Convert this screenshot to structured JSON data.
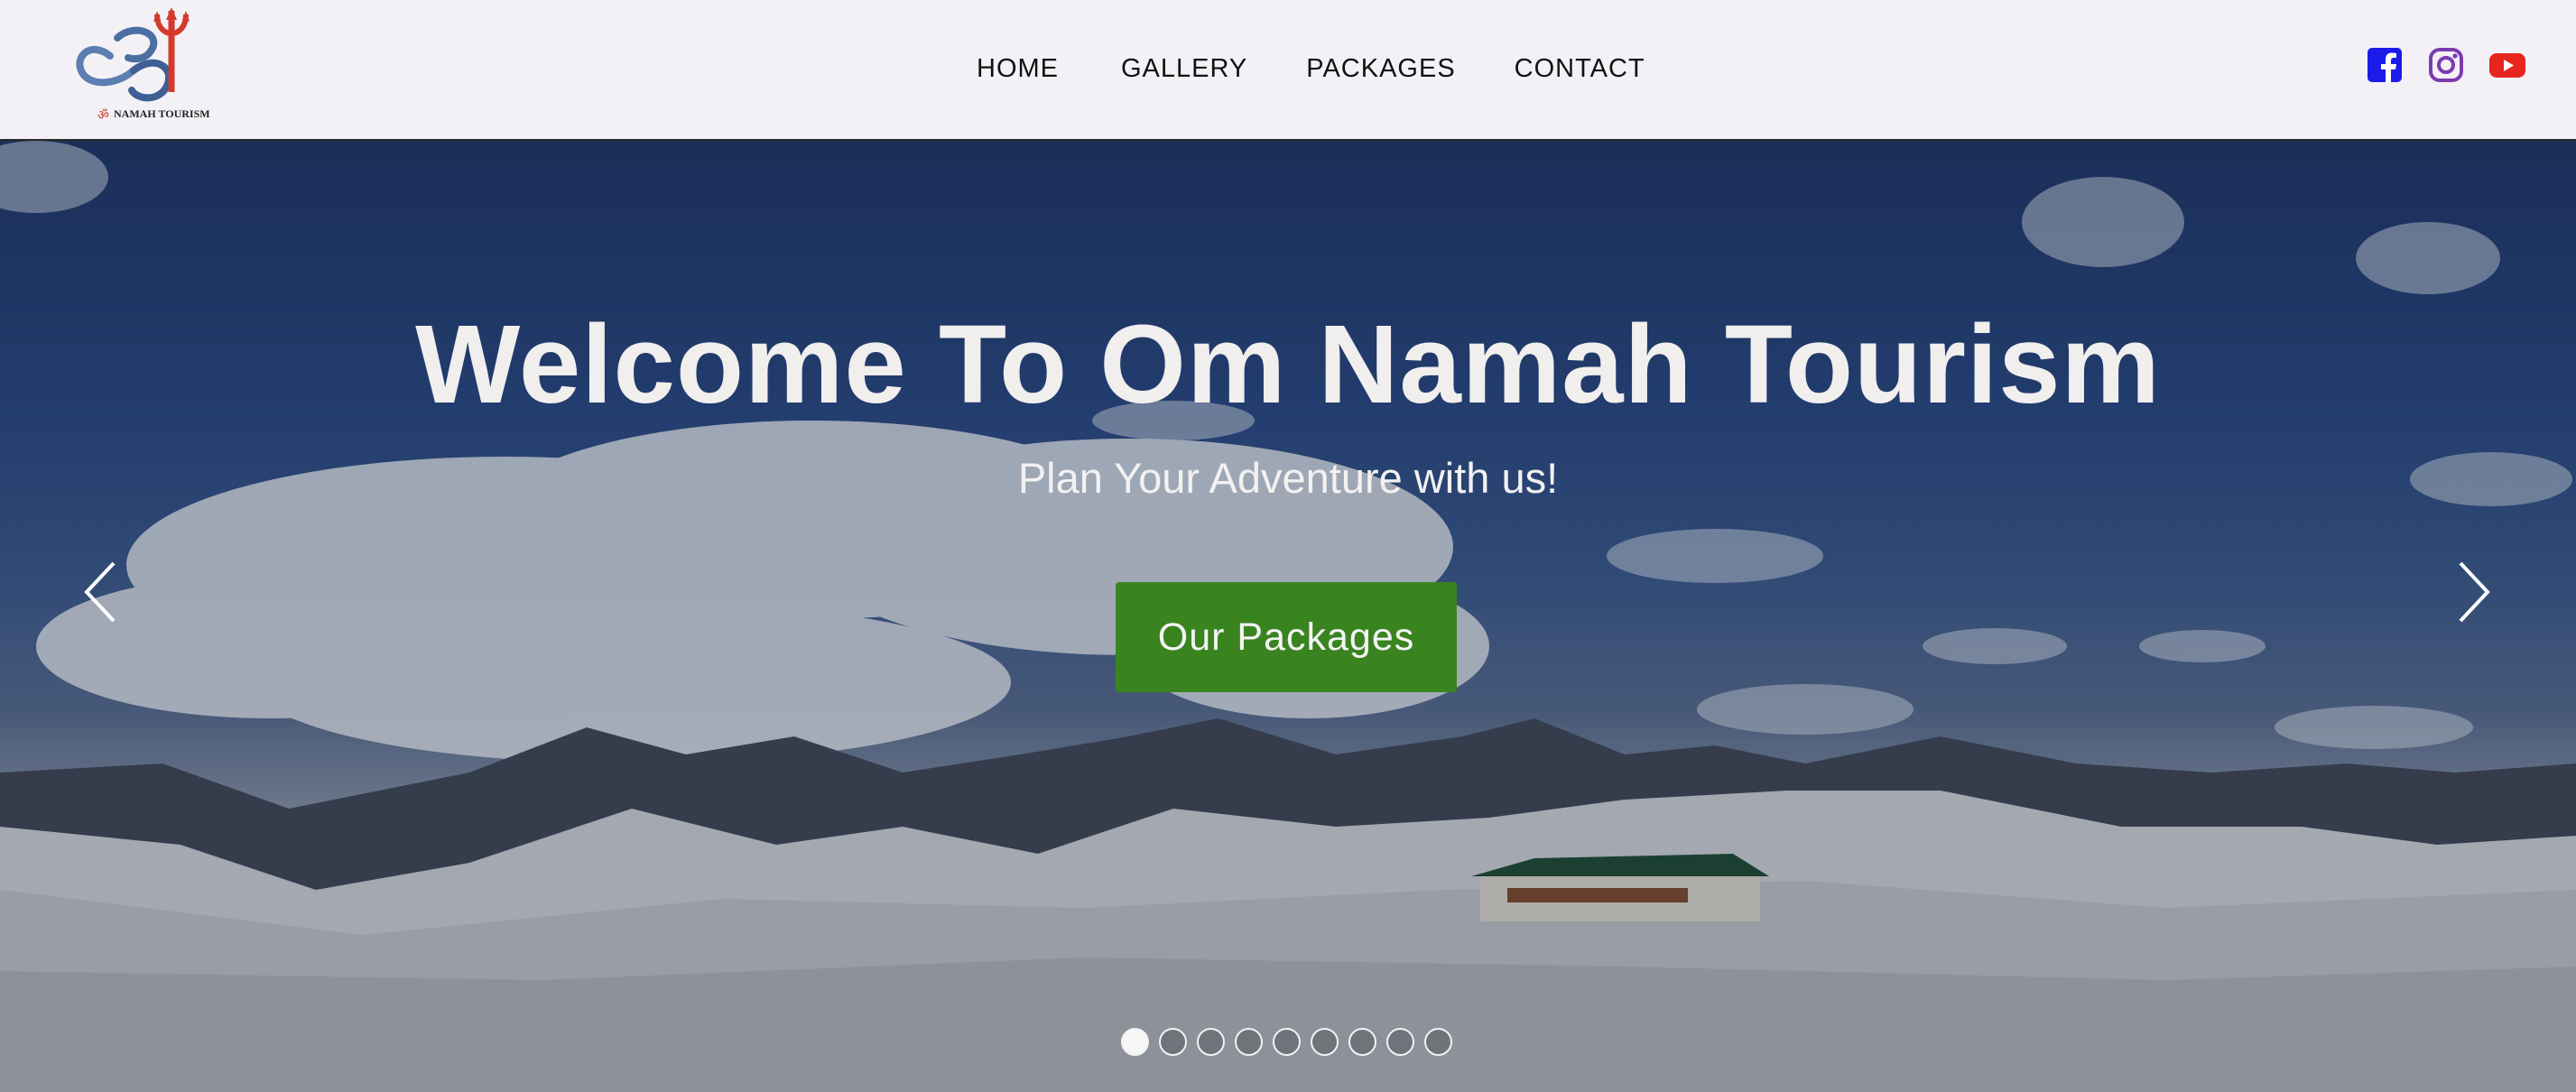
{
  "brand": {
    "logo_text": "NAMAH TOURISM",
    "logo_glyph": "ॐ",
    "logo_mark_text": "3"
  },
  "nav": {
    "items": [
      {
        "label": "HOME"
      },
      {
        "label": "GALLERY"
      },
      {
        "label": "PACKAGES"
      },
      {
        "label": "CONTACT"
      }
    ]
  },
  "socials": [
    {
      "name": "facebook-icon",
      "color": "#1b1bea"
    },
    {
      "name": "instagram-icon",
      "color": "#7b3bb1"
    },
    {
      "name": "youtube-icon",
      "color": "#e8241f"
    }
  ],
  "hero": {
    "title": "Welcome To Om Namah Tourism",
    "subtitle": "Plan Your Adventure with us!",
    "button_label": "Our Packages",
    "button_color": "#3a8420",
    "slide_count": 9,
    "active_slide": 1
  },
  "colors": {
    "navbar_bg": "#f4f1f6",
    "title_text": "#f1eeee"
  }
}
